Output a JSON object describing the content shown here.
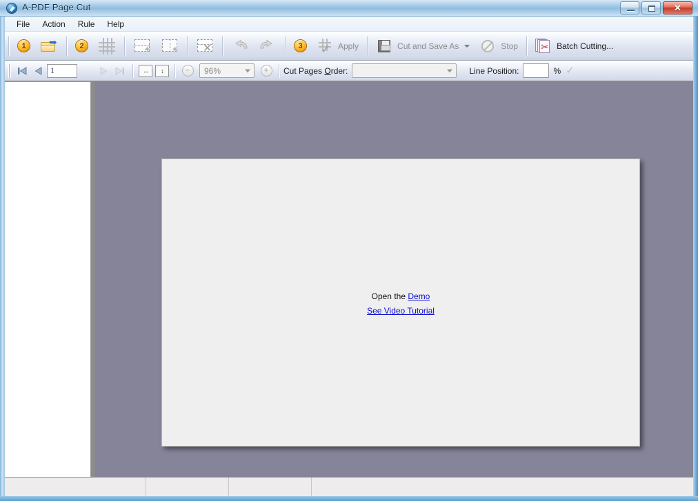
{
  "window": {
    "title": "A-PDF Page Cut",
    "app_icon": "globe-pen-icon",
    "minimize_label": "Minimize",
    "maximize_label": "Maximize",
    "close_label": "Close",
    "close_glyph": "✕"
  },
  "menubar": {
    "items": [
      {
        "label": "File",
        "name": "menu-file"
      },
      {
        "label": "Action",
        "name": "menu-action"
      },
      {
        "label": "Rule",
        "name": "menu-rule"
      },
      {
        "label": "Help",
        "name": "menu-help"
      }
    ]
  },
  "toolbar": {
    "step1_badge": "1",
    "open_label": "Open",
    "step2_badge": "2",
    "grid_label": "Set Grid",
    "add_vline_label": "Add Vertical Line",
    "add_hline_label": "Add Horizontal Line",
    "delete_line_label": "Delete Line",
    "undo_label": "Undo",
    "redo_label": "Redo",
    "step3_badge": "3",
    "apply_label": "Apply",
    "cut_save_label": "Cut and Save As",
    "cut_save_accesskey": "C",
    "stop_label": "Stop",
    "stop_accesskey": "S",
    "batch_label": "Batch Cutting...",
    "batch_accesskey": "B"
  },
  "navbar": {
    "first_label": "First Page",
    "prev_label": "Previous Page",
    "page_value": "1",
    "next_label": "Next Page",
    "last_label": "Last Page",
    "fit_width_label": "Fit Width",
    "fit_height_label": "Fit Height",
    "zoom_out_glyph": "−",
    "zoom_value": "96%",
    "zoom_in_glyph": "+",
    "cut_pages_order_label": "Cut Pages Order:",
    "cut_pages_order_accesskey": "O",
    "cut_pages_order_value": "",
    "line_position_label": "Line Position:",
    "line_position_value": "",
    "percent_label": "%",
    "apply_check_glyph": "✓"
  },
  "document": {
    "open_the_text": "Open the",
    "demo_link": "Demo",
    "video_tutorial_link": "See Video Tutorial",
    "background_color": "#868499",
    "page_color": "#efeff0"
  },
  "statusbar": {
    "cells": [
      "",
      "",
      "",
      ""
    ]
  }
}
